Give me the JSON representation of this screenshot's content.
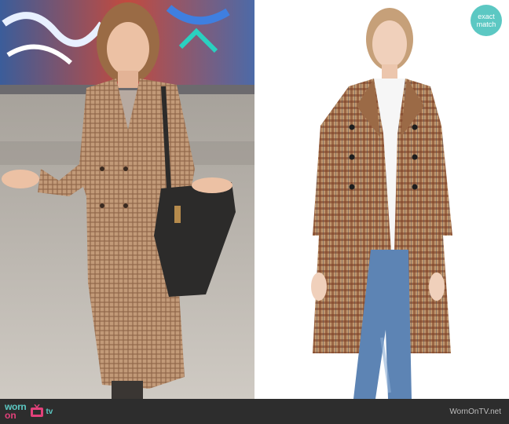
{
  "badge": {
    "line1": "exact",
    "line2": "match"
  },
  "footer": {
    "logo": {
      "worn": "worn",
      "on": "on",
      "tv": "tv"
    },
    "site": "WornOnTV.net"
  },
  "colors": {
    "accent_teal": "#5cc8c3",
    "accent_pink": "#e2417a",
    "footer_bg": "#2d2d2d",
    "coat_tan": "#b98e6a",
    "coat_rust": "#a8643c"
  }
}
